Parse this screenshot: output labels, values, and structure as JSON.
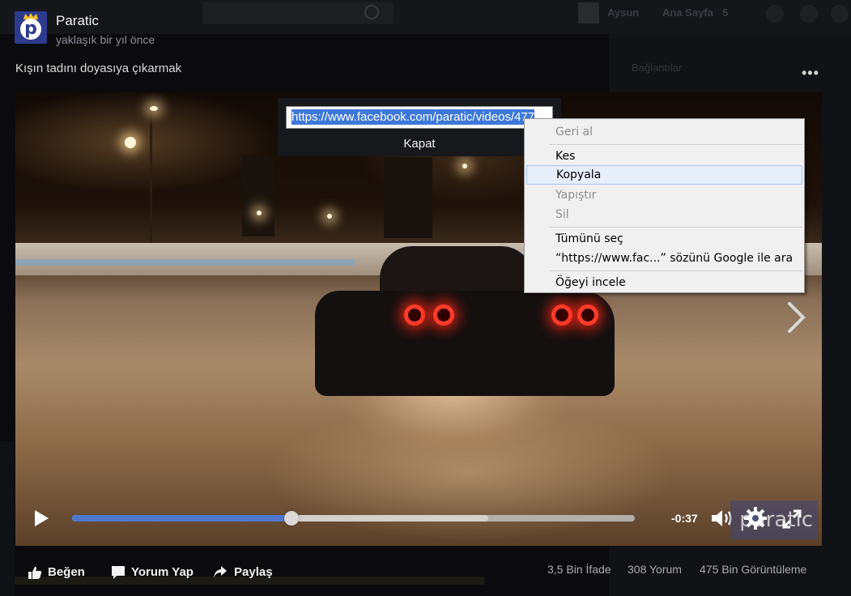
{
  "background": {
    "nav_name": "Aysun",
    "nav_home": "Ana Sayfa",
    "nav_home_count": "5",
    "right_panel_title": "Bağlantılar"
  },
  "post": {
    "page_name": "Paratic",
    "time": "yaklaşık bir yıl önce",
    "caption": "Kışın tadını doyasıya çıkarmak",
    "more_label": "•••"
  },
  "video": {
    "progress_fraction": 0.39,
    "buffered_fraction": 0.74,
    "time_remaining": "-0:37",
    "watermark": "paratic"
  },
  "url_popup": {
    "url_value": "https://www.facebook.com/paratic/videos/477",
    "close_label": "Kapat"
  },
  "context_menu": {
    "items": [
      {
        "label": "Geri al",
        "disabled": true
      },
      {
        "label": "Kes",
        "disabled": false
      },
      {
        "label": "Kopyala",
        "disabled": false,
        "hover": true
      },
      {
        "label": "Yapıştır",
        "disabled": true
      },
      {
        "label": "Sil",
        "disabled": true
      },
      {
        "label": "Tümünü seç",
        "disabled": false
      },
      {
        "label": "“https://www.fac...” sözünü Google ile ara",
        "disabled": false
      },
      {
        "label": "Öğeyi incele",
        "disabled": false
      }
    ]
  },
  "actions": {
    "like": "Beğen",
    "comment": "Yorum Yap",
    "share": "Paylaş"
  },
  "stats": {
    "reactions": "3,5 Bin İfade",
    "comments": "308 Yorum",
    "views": "475 Bin Görüntüleme"
  }
}
